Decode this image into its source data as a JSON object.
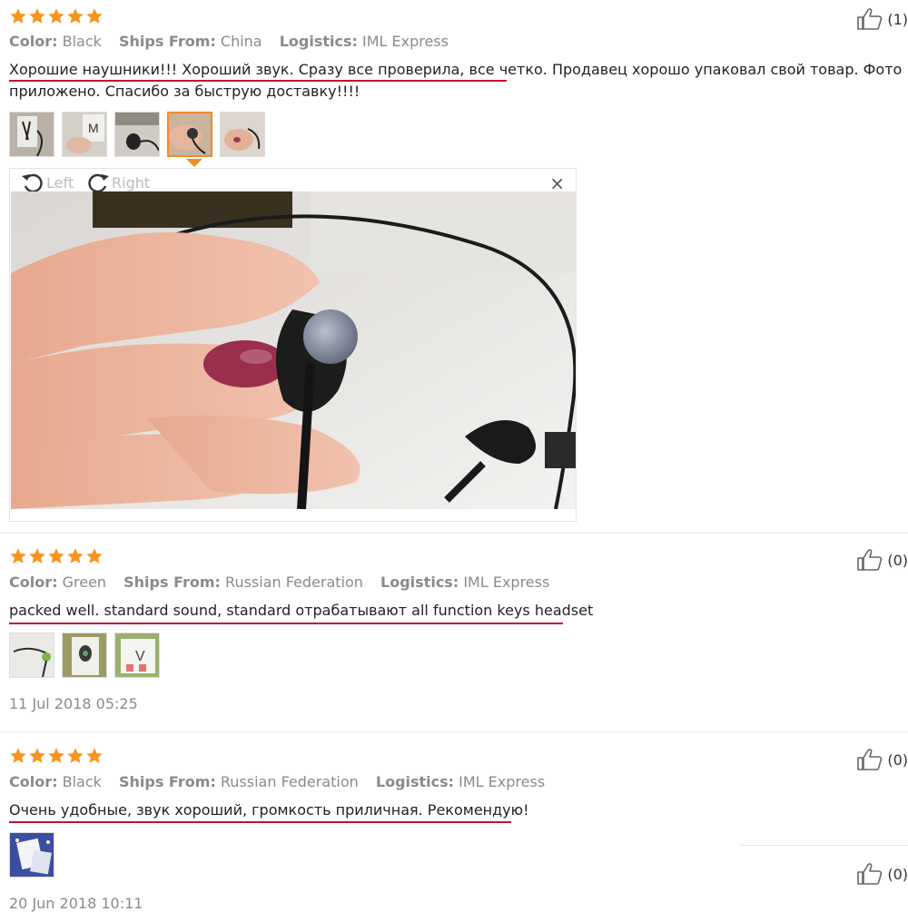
{
  "reviews": [
    {
      "rating": 5,
      "color_label": "Color:",
      "color": "Black",
      "ships_label": "Ships From:",
      "ships": "China",
      "logistics_label": "Logistics:",
      "logistics": "IML Express",
      "text_line1": "Хорошие наушники!!! Хороший звук. Сразу все проверила, все четко. Продавец хорошо упаковал свой товар. Фото",
      "text_line2": "приложено. Спасибо за быструю доставку!!!!",
      "helpful": "(1)",
      "photo_count": 5,
      "selected_photo": 4
    },
    {
      "rating": 5,
      "color_label": "Color:",
      "color": "Green",
      "ships_label": "Ships From:",
      "ships": "Russian Federation",
      "logistics_label": "Logistics:",
      "logistics": "IML Express",
      "text_line1": "packed well. standard sound, standard отрабатывают all function keys headset",
      "helpful": "(0)",
      "photo_count": 3,
      "date": "11 Jul 2018 05:25"
    },
    {
      "rating": 5,
      "color_label": "Color:",
      "color": "Black",
      "ships_label": "Ships From:",
      "ships": "Russian Federation",
      "logistics_label": "Logistics:",
      "logistics": "IML Express",
      "text_line1": "Очень удобные, звук хороший, громкость приличная. Рекомендую!",
      "helpful": "(0)",
      "photo_count": 1,
      "date": "20 Jun 2018 10:11"
    }
  ],
  "next_review": {
    "helpful": "(0)"
  },
  "viewer": {
    "rotate_left_label": "Left",
    "rotate_right_label": "Right",
    "close_glyph": "×"
  },
  "icons": {
    "star": "star-icon",
    "thumbs_up": "thumbs-up-icon",
    "rotate_left": "rotate-left-icon",
    "rotate_right": "rotate-right-icon",
    "close": "close-icon"
  },
  "colors": {
    "star": "#f7941d",
    "underline": "#c8102e",
    "selected_border": "#f28c28",
    "meta_text": "#8a8a8a"
  }
}
